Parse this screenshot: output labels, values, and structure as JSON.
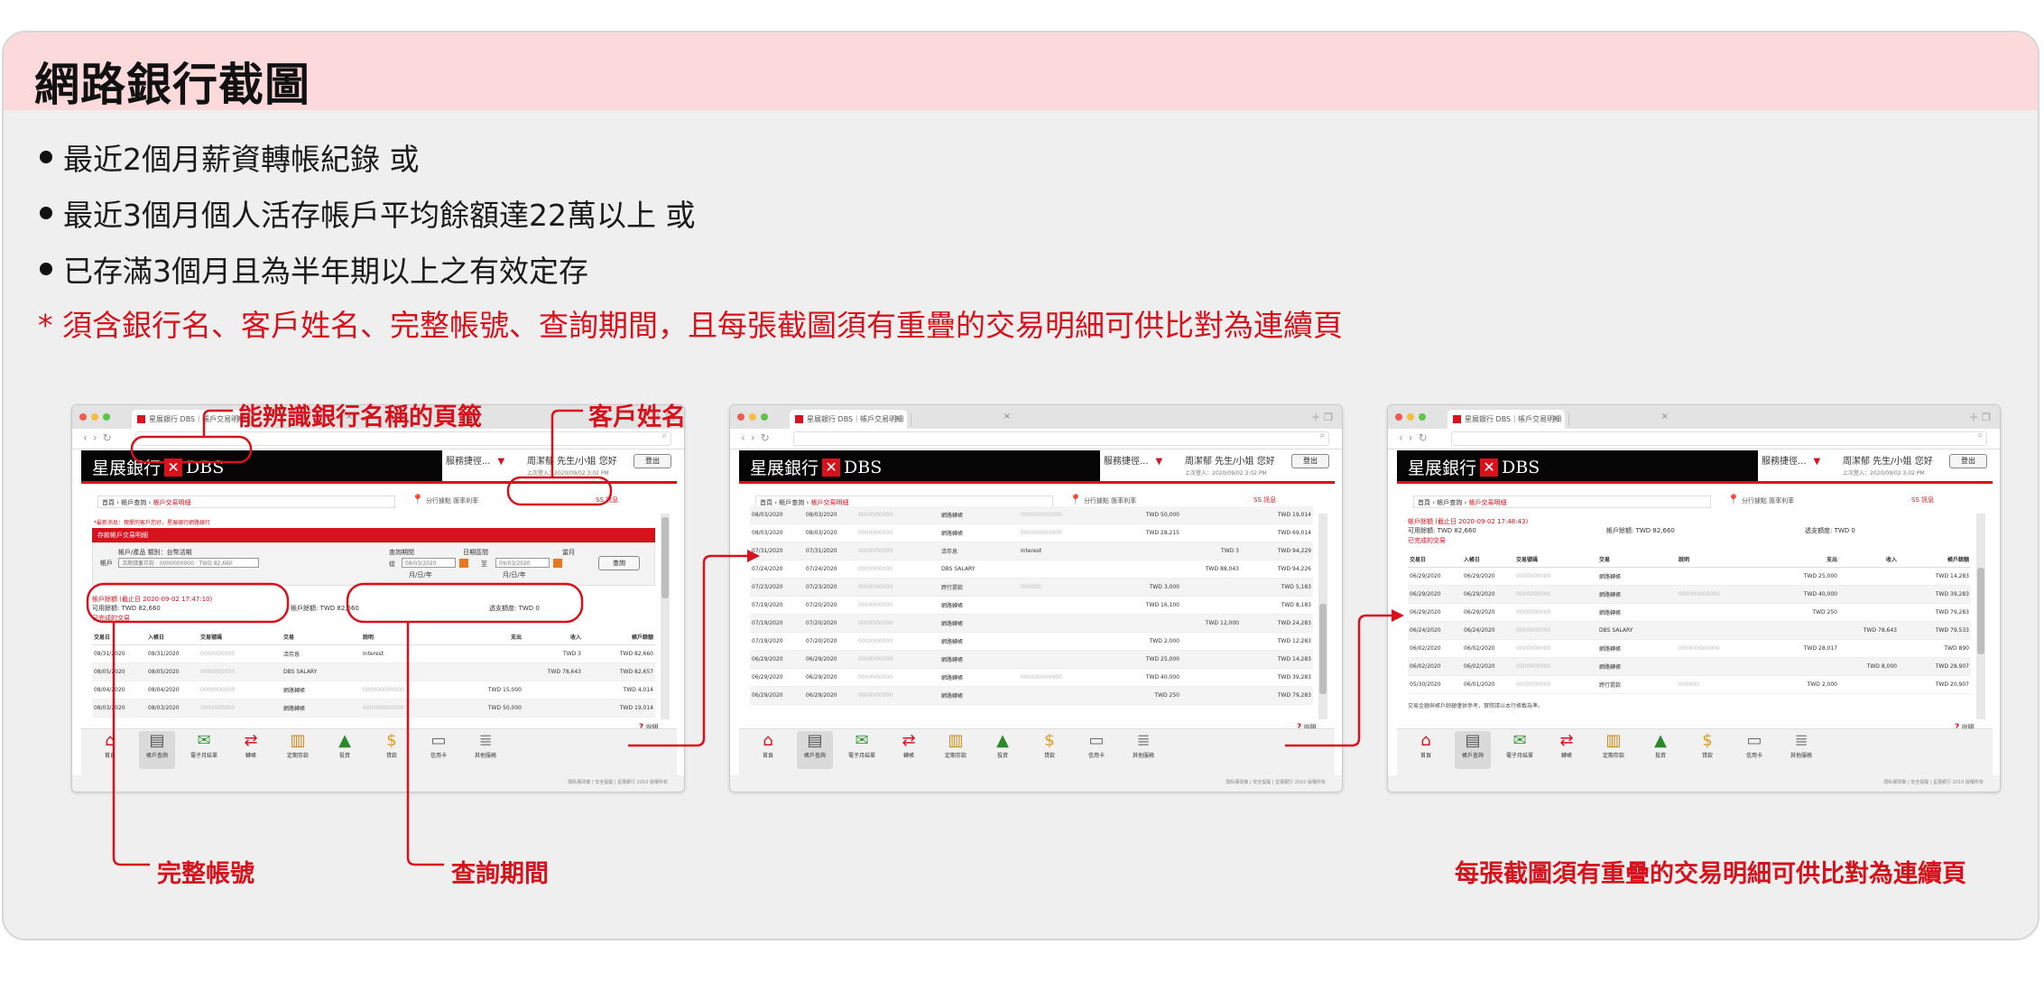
{
  "title": "網路銀行截圖",
  "bullets": [
    "最近2個月薪資轉帳紀錄 或",
    "最近3個月個人活存帳戶平均餘額達22萬以上 或",
    "已存滿3個月且為半年期以上之有效定存"
  ],
  "note": "* 須含銀行名、客戶姓名、完整帳號、查詢期間，且每張截圖須有重疊的交易明細可供比對為連續頁",
  "callouts": {
    "tab": "能辨識銀行名稱的頁籤",
    "customer": "客戶姓名",
    "account": "完整帳號",
    "period": "查詢期間",
    "overlap": "每張截圖須有重疊的交易明細可供比對為連續頁"
  },
  "colors": {
    "accent": "#d6121d",
    "header_bg": "#fcd9db",
    "card_bg": "#efefef"
  },
  "browser": {
    "tab_label": "星展銀行 DBS｜帳戶交易明細",
    "logo": "星展銀行",
    "logo_mark": "✕",
    "brand": "DBS",
    "quick_menu": "服務捷徑...",
    "greeting": "周潔郁 先生/小姐 您好",
    "logout": "登出",
    "last_login": "上次登入：2020/09/02 3:02 PM",
    "breadcrumb_home": "首頁",
    "breadcrumb_sep": "›",
    "breadcrumb_query": "帳戶查詢",
    "breadcrumb_current": "帳戶交易明細",
    "crumb_links": "分行據點  匯率利率",
    "font_size": "SS  訊息",
    "help": "說明",
    "footer": "隱私權政策 | 安全提醒 | 星展銀行 2010 版權所有",
    "account_title": "存款帳戶交易明細",
    "red_notice": "*最新消息：親愛的客戶您好，星展銀行網路銀行",
    "filter": {
      "account_type_label": "帳戶/產品 類別：台幣活期",
      "account_label": "帳戶",
      "account_value": "活期儲蓄存款 · 0000000000 · TWD 82,660",
      "period_label": "查詢期間",
      "opt_date": "日期區間",
      "opt_month": "當月",
      "from_label": "從",
      "from": "08/03/2020",
      "to_label": "至",
      "to": "09/03/2020",
      "date_fmt": "月/日/年",
      "query_btn": "查詢"
    },
    "summary_title": "帳戶餘額 (截止日 2020-09-02 17:48:43)",
    "summary_title_1": "帳戶餘額 (截止日 2020-09-02 17:47:10)",
    "available": "可用餘額: TWD 82,660",
    "account_bal": "帳戶餘額: TWD 82,660",
    "overdraft": "透支額度: TWD 0",
    "done_txn": "已完成的交易",
    "columns": [
      "交易日",
      "入帳日",
      "交易號碼",
      "交易",
      "說明",
      "支出",
      "收入",
      "帳戶餘額"
    ],
    "nav_items": [
      "首頁",
      "帳戶查詢",
      "電子月結單",
      "轉帳",
      "定期存款",
      "投資",
      "貸款",
      "信用卡",
      "其他服務"
    ],
    "nav_glyphs": [
      "⌂",
      "▤",
      "✉",
      "⇄",
      "▥",
      "▲",
      "$",
      "▭",
      "≣"
    ],
    "info_note": "交易金額與帳戶餘額僅供參考，實際請以本行帳載為準。"
  },
  "screens": [
    {
      "rows": [
        [
          "08/31/2020",
          "08/31/2020",
          "0000000000",
          "活存息",
          "Interest",
          "",
          "TWD 3",
          "TWD 82,660"
        ],
        [
          "08/05/2020",
          "08/05/2020",
          "0000000000",
          "DBS SALARY",
          "",
          "",
          "TWD 78,643",
          "TWD 82,657"
        ],
        [
          "08/04/2020",
          "08/04/2020",
          "0000000000",
          "網路轉帳",
          "000000000000",
          "TWD 15,000",
          "",
          "TWD 4,014"
        ],
        [
          "08/03/2020",
          "08/03/2020",
          "0000000000",
          "網路轉帳",
          "000000000000",
          "TWD 50,000",
          "",
          "TWD 19,014"
        ]
      ]
    },
    {
      "rows": [
        [
          "08/03/2020",
          "08/03/2020",
          "0000000000",
          "網路轉帳",
          "000000000000",
          "TWD 50,000",
          "",
          "TWD 19,014"
        ],
        [
          "08/03/2020",
          "08/03/2020",
          "0000000000",
          "網路轉帳",
          "000000000000",
          "TWD 28,215",
          "",
          "TWD 69,014"
        ],
        [
          "07/31/2020",
          "07/31/2020",
          "0000000000",
          "活存息",
          "Interest",
          "",
          "TWD 3",
          "TWD 94,229"
        ],
        [
          "07/24/2020",
          "07/24/2020",
          "0000000000",
          "DBS SALARY",
          "",
          "",
          "TWD 88,043",
          "TWD 94,226"
        ],
        [
          "07/23/2020",
          "07/23/2020",
          "0000000000",
          "跨行提款",
          "000000",
          "TWD 3,000",
          "",
          "TWD 5,183"
        ],
        [
          "07/19/2020",
          "07/20/2020",
          "0000000000",
          "網路轉帳",
          "",
          "TWD 16,100",
          "",
          "TWD 8,183"
        ],
        [
          "07/19/2020",
          "07/20/2020",
          "0000000000",
          "網路轉帳",
          "",
          "",
          "TWD 12,000",
          "TWD 24,283"
        ],
        [
          "07/19/2020",
          "07/20/2020",
          "0000000000",
          "網路轉帳",
          "",
          "TWD 2,000",
          "",
          "TWD 12,283"
        ],
        [
          "06/29/2020",
          "06/29/2020",
          "0000000000",
          "網路轉帳",
          "",
          "TWD 25,000",
          "",
          "TWD 14,283"
        ],
        [
          "06/29/2020",
          "06/29/2020",
          "0000000000",
          "網路轉帳",
          "000000000000",
          "TWD 40,000",
          "",
          "TWD 39,283"
        ],
        [
          "06/29/2020",
          "06/29/2020",
          "0000000000",
          "網路轉帳",
          "",
          "TWD 250",
          "",
          "TWD 79,283"
        ]
      ]
    },
    {
      "rows": [
        [
          "06/29/2020",
          "06/29/2020",
          "0000000000",
          "網路轉帳",
          "",
          "TWD 25,000",
          "",
          "TWD 14,283"
        ],
        [
          "06/29/2020",
          "06/29/2020",
          "0000000000",
          "網路轉帳",
          "000000000000",
          "TWD 40,000",
          "",
          "TWD 39,283"
        ],
        [
          "06/29/2020",
          "06/29/2020",
          "0000000000",
          "網路轉帳",
          "",
          "TWD 250",
          "",
          "TWD 79,283"
        ],
        [
          "06/24/2020",
          "06/24/2020",
          "0000000000",
          "DBS SALARY",
          "",
          "",
          "TWD 78,643",
          "TWD 79,533"
        ],
        [
          "06/02/2020",
          "06/02/2020",
          "0000000000",
          "網路轉帳",
          "000000000000",
          "TWD 28,017",
          "",
          "TWD 890"
        ],
        [
          "06/02/2020",
          "06/02/2020",
          "0000000000",
          "網路轉帳",
          "",
          "",
          "TWD 8,000",
          "TWD 28,907"
        ],
        [
          "05/30/2020",
          "06/01/2020",
          "0000000000",
          "跨行提款",
          "000000",
          "TWD 2,000",
          "",
          "TWD 20,907"
        ]
      ]
    }
  ]
}
